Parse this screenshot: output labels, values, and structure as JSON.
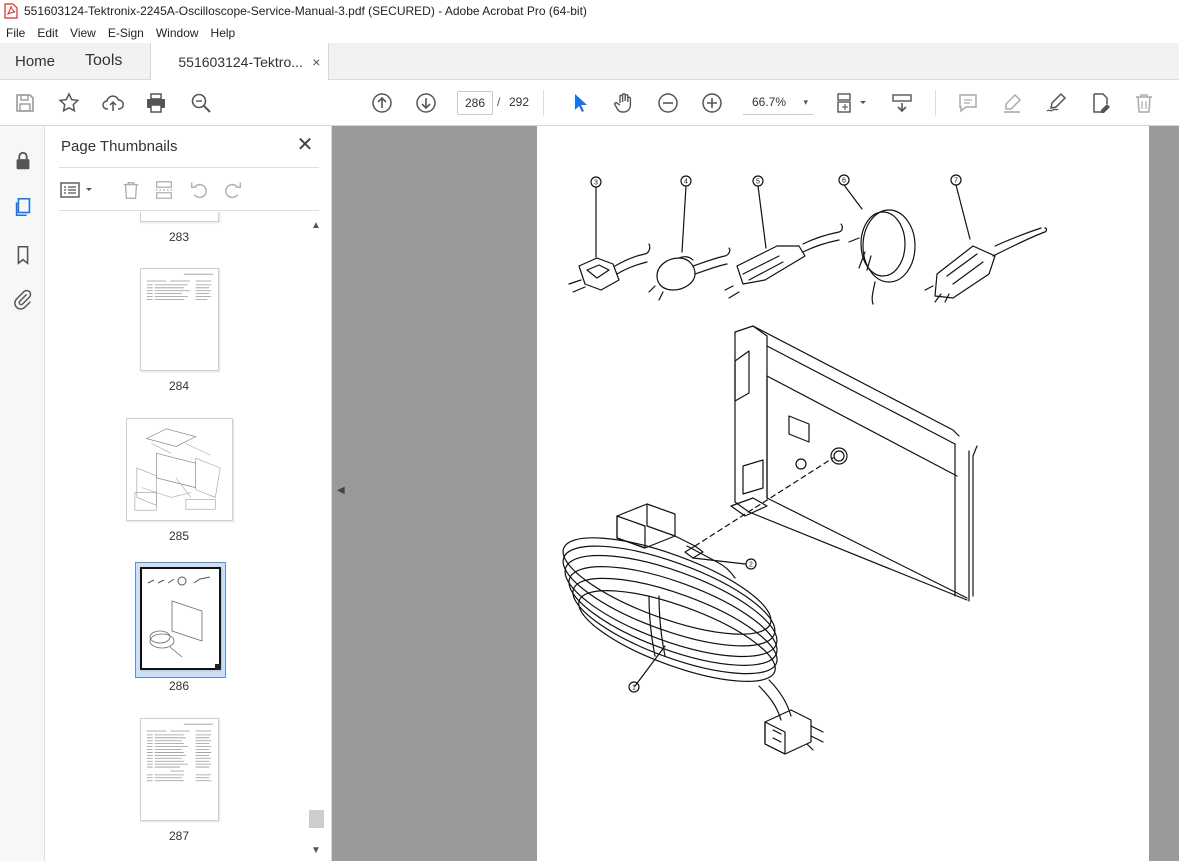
{
  "window": {
    "title": "551603124-Tektronix-2245A-Oscilloscope-Service-Manual-3.pdf (SECURED) - Adobe Acrobat Pro (64-bit)"
  },
  "menu": [
    "File",
    "Edit",
    "View",
    "E-Sign",
    "Window",
    "Help"
  ],
  "tabs": {
    "home": "Home",
    "tools": "Tools",
    "document": "551603124-Tektro...",
    "close": "×"
  },
  "toolbar": {
    "current_page": "286",
    "page_separator": "/",
    "total_pages": "292",
    "zoom": "66.7%",
    "zoom_caret": "▾"
  },
  "panel": {
    "title": "Page Thumbnails",
    "close": "✕",
    "thumbnails": [
      {
        "label": "283"
      },
      {
        "label": "284"
      },
      {
        "label": "285"
      },
      {
        "label": "286",
        "selected": true
      },
      {
        "label": "287"
      }
    ],
    "scroll_up": "▲",
    "scroll_down": "▼"
  },
  "document": {
    "collapse_arrow": "◀",
    "callouts": [
      "3",
      "4",
      "5",
      "6",
      "7",
      "2",
      "1"
    ]
  },
  "colors": {
    "accent": "#1473e6",
    "pdf_red": "#d32f2f",
    "canvas_gray": "#9a9a9a",
    "selection": "#cfe0f4"
  }
}
